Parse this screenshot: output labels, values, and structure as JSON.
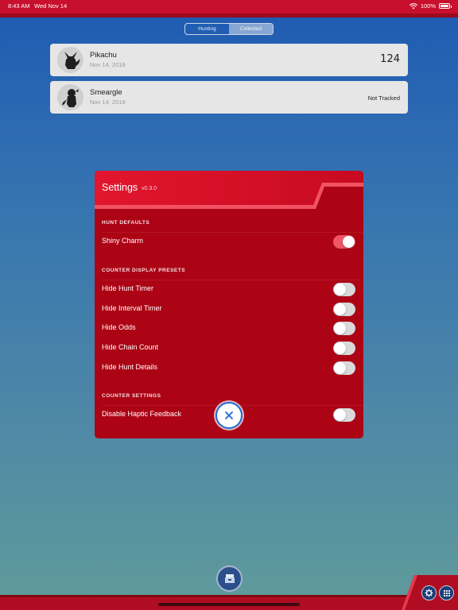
{
  "status_bar": {
    "time": "8:43 AM",
    "date": "Wed Nov 14",
    "battery": "100%"
  },
  "tabs": [
    {
      "label": "Hunting",
      "active": false
    },
    {
      "label": "Collected",
      "active": true
    }
  ],
  "pokemon": [
    {
      "name": "Pikachu",
      "date": "Nov 14, 2018",
      "count": "124"
    },
    {
      "name": "Smeargle",
      "date": "Nov 14, 2018",
      "status": "Not Tracked"
    }
  ],
  "settings": {
    "title": "Settings",
    "version": "v0.3.0",
    "sections": [
      {
        "heading": "HUNT DEFAULTS",
        "items": [
          {
            "label": "Shiny Charm",
            "on": true
          }
        ]
      },
      {
        "heading": "COUNTER DISPLAY PRESETS",
        "items": [
          {
            "label": "Hide Hunt Timer",
            "on": false
          },
          {
            "label": "Hide Interval Timer",
            "on": false
          },
          {
            "label": "Hide Odds",
            "on": false
          },
          {
            "label": "Hide Chain Count",
            "on": false
          },
          {
            "label": "Hide Hunt Details",
            "on": false
          }
        ]
      },
      {
        "heading": "COUNTER SETTINGS",
        "items": [
          {
            "label": "Disable Haptic Feedback",
            "on": false
          }
        ]
      }
    ]
  },
  "icons": {
    "close": "close-icon",
    "center": "storage-box-icon",
    "settings": "gear-icon",
    "grid": "grid-icon"
  },
  "colors": {
    "accent_red": "#c8102e",
    "modal_red": "#ac0415",
    "toggle_on": "#ef5666",
    "close_blue": "#1e6ad8"
  }
}
